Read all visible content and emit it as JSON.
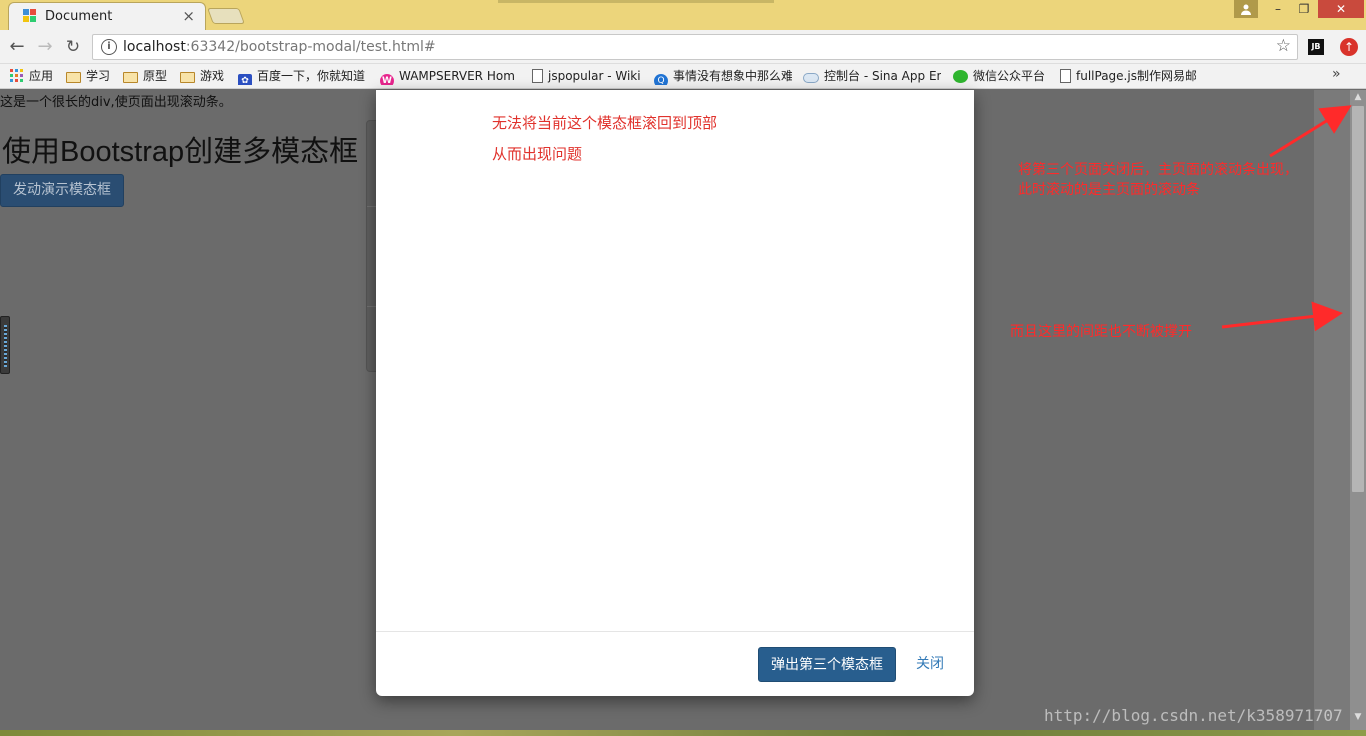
{
  "browser": {
    "tab_title": "Document",
    "tab_close": "×",
    "url_host": "localhost",
    "url_path": ":63342/bootstrap-modal/test.html#",
    "window_min": "–",
    "window_max": "❐",
    "window_close": "✕"
  },
  "bookmarks": [
    {
      "label": "应用",
      "icon": "apps-icon"
    },
    {
      "label": "学习",
      "icon": "folder-icon"
    },
    {
      "label": "原型",
      "icon": "folder-icon"
    },
    {
      "label": "游戏",
      "icon": "folder-icon"
    },
    {
      "label": "百度一下，你就知道",
      "icon": "baidu-icon"
    },
    {
      "label": "WAMPSERVER Hom",
      "icon": "wamp-icon"
    },
    {
      "label": "jspopular - Wiki",
      "icon": "page-icon"
    },
    {
      "label": "事情没有想象中那么难",
      "icon": "q-icon"
    },
    {
      "label": "控制台 - Sina App En",
      "icon": "cloud-icon"
    },
    {
      "label": "微信公众平台",
      "icon": "wechat-icon"
    },
    {
      "label": "fullPage.js制作网易邮",
      "icon": "page-icon"
    }
  ],
  "bookmarks_more": "»",
  "page": {
    "note": "这是一个很长的div,使页面出现滚动条。",
    "title": "使用Bootstrap创建多模态框",
    "launch_button": "发动演示模态框"
  },
  "modal": {
    "annotation_line1": "无法将当前这个模态框滚回到顶部",
    "annotation_line2": "从而出现问题",
    "primary_button": "弹出第三个模态框",
    "close_button": "关闭"
  },
  "annotations": {
    "right_note_1": "将第三个页面关闭后，主页面的滚动条出现，此时滚动的是主页面的滚动条",
    "right_note_2": "而且这里的间距也不断被撑开"
  },
  "watermark": "http://blog.csdn.net/k358971707",
  "colors": {
    "annotation_red": "#ff2a2a",
    "primary_blue": "#285e8e",
    "overlay_gray": "#6b6b6b"
  }
}
